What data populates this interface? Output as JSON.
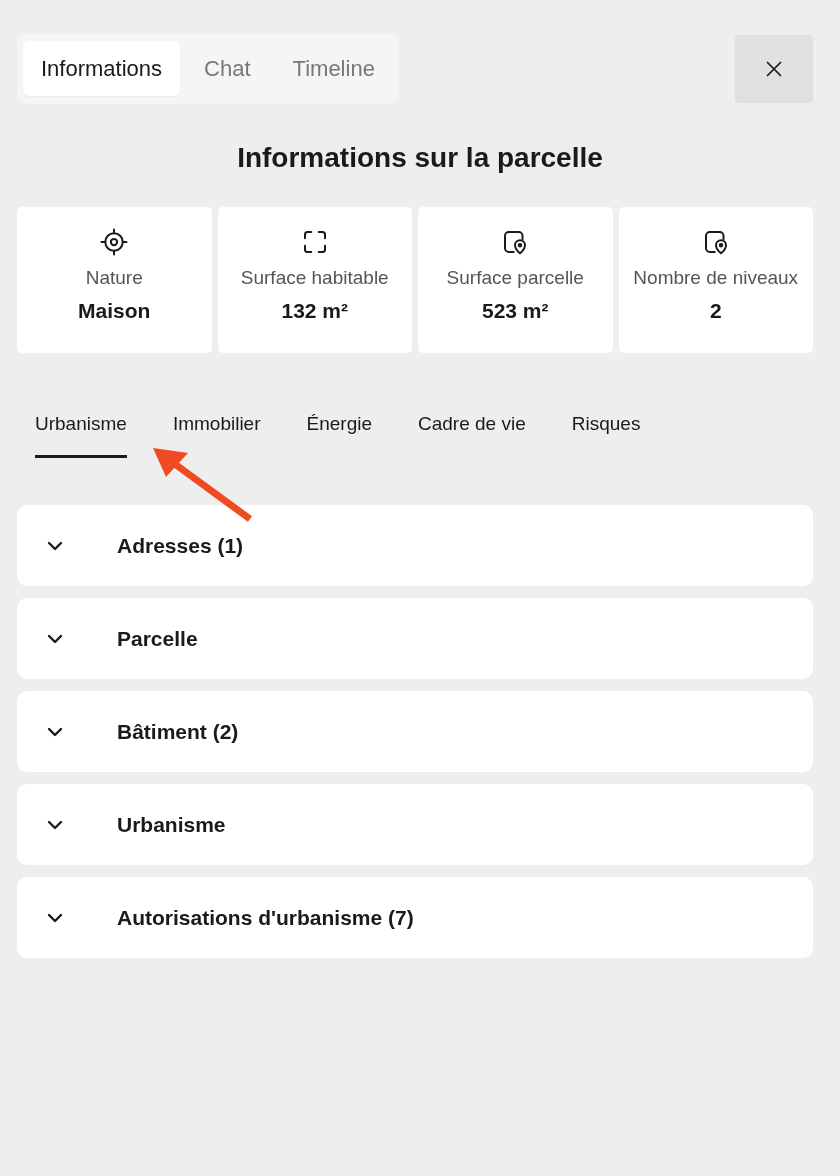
{
  "top_tabs": [
    {
      "label": "Informations",
      "selected": true
    },
    {
      "label": "Chat",
      "selected": false
    },
    {
      "label": "Timeline",
      "selected": false
    }
  ],
  "title": "Informations sur la parcelle",
  "stats": [
    {
      "label": "Nature",
      "value": "Maison"
    },
    {
      "label": "Surface habitable",
      "value": "132 m²"
    },
    {
      "label": "Surface parcelle",
      "value": "523 m²"
    },
    {
      "label": "Nombre de niveaux",
      "value": "2"
    }
  ],
  "section_tabs": [
    {
      "label": "Urbanisme",
      "selected": true
    },
    {
      "label": "Immobilier",
      "selected": false
    },
    {
      "label": "Énergie",
      "selected": false
    },
    {
      "label": "Cadre de vie",
      "selected": false
    },
    {
      "label": "Risques",
      "selected": false
    }
  ],
  "sections": [
    {
      "title": "Adresses (1)",
      "expanded": false
    },
    {
      "title": "Parcelle",
      "expanded": false
    },
    {
      "title": "Bâtiment (2)",
      "expanded": false
    },
    {
      "title": "Urbanisme",
      "expanded": false
    },
    {
      "title": "Autorisations d'urbanisme (7)",
      "expanded": false
    }
  ]
}
